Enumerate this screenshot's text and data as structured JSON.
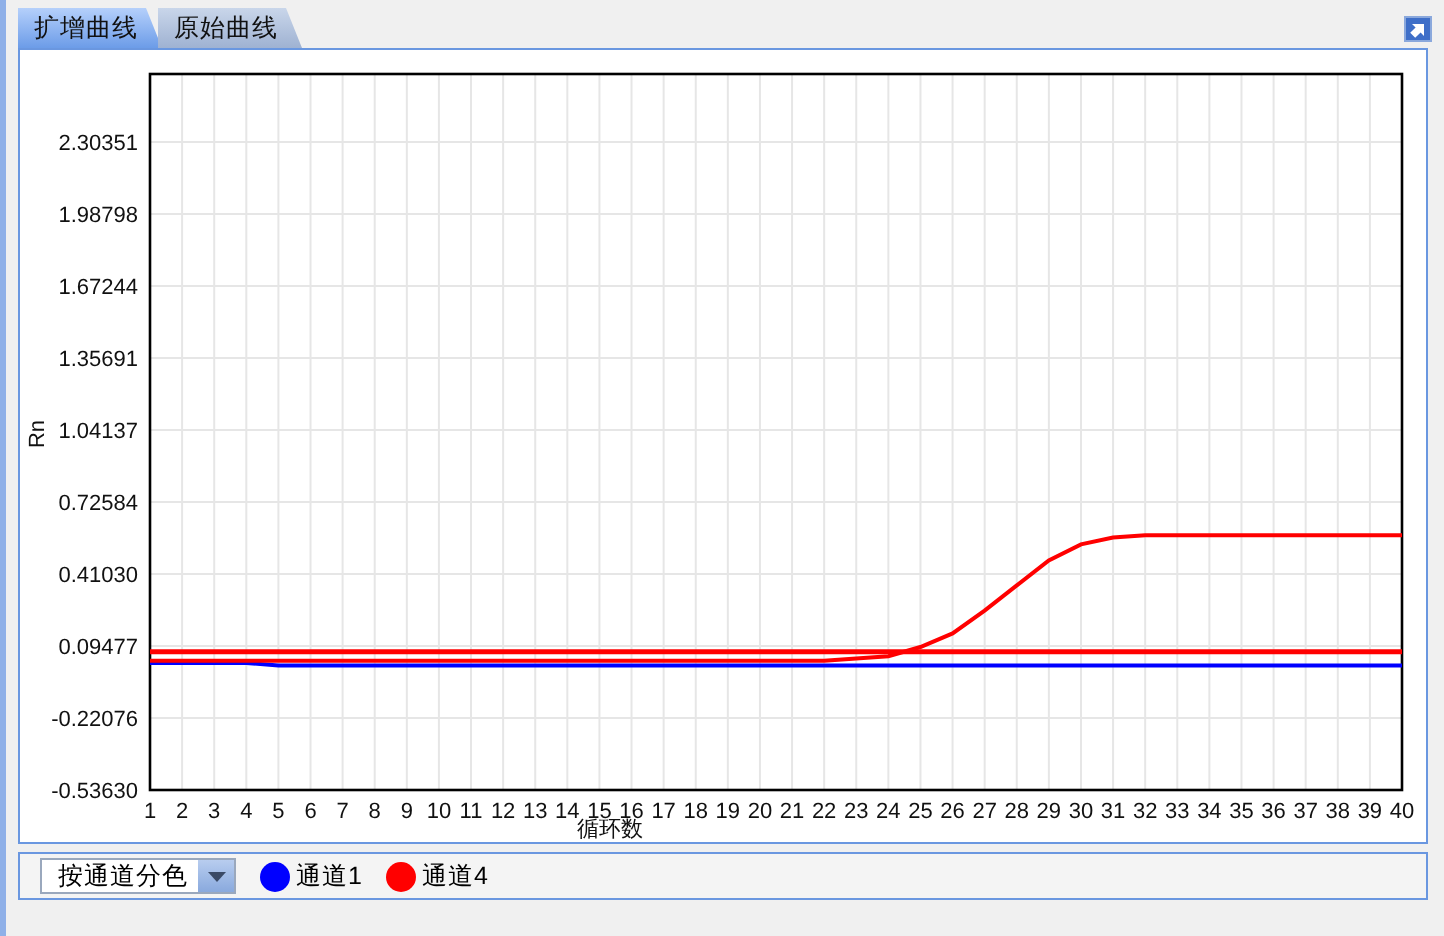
{
  "tabs": [
    {
      "label": "扩增曲线",
      "selected": true
    },
    {
      "label": "原始曲线",
      "selected": false
    }
  ],
  "chart": {
    "chart_data": {
      "type": "line",
      "xlabel": "循环数",
      "ylabel": "Rn",
      "grid": true,
      "x": [
        1,
        2,
        3,
        4,
        5,
        6,
        7,
        8,
        9,
        10,
        11,
        12,
        13,
        14,
        15,
        16,
        17,
        18,
        19,
        20,
        21,
        22,
        23,
        24,
        25,
        26,
        27,
        28,
        29,
        30,
        31,
        32,
        33,
        34,
        35,
        36,
        37,
        38,
        39,
        40
      ],
      "xlim": [
        1,
        40
      ],
      "ylim": [
        -0.5363,
        2.6015
      ],
      "xticks": [
        1,
        2,
        3,
        4,
        5,
        6,
        7,
        8,
        9,
        10,
        11,
        12,
        13,
        14,
        15,
        16,
        17,
        18,
        19,
        20,
        21,
        22,
        23,
        24,
        25,
        26,
        27,
        28,
        29,
        30,
        31,
        32,
        33,
        34,
        35,
        36,
        37,
        38,
        39,
        40
      ],
      "yticks": [
        {
          "value": -0.5363,
          "label": "-0.53630"
        },
        {
          "value": -0.22076,
          "label": "-0.22076"
        },
        {
          "value": 0.09477,
          "label": "0.09477"
        },
        {
          "value": 0.4103,
          "label": "0.41030"
        },
        {
          "value": 0.72584,
          "label": "0.72584"
        },
        {
          "value": 1.04137,
          "label": "1.04137"
        },
        {
          "value": 1.35691,
          "label": "1.35691"
        },
        {
          "value": 1.67244,
          "label": "1.67244"
        },
        {
          "value": 1.98798,
          "label": "1.98798"
        },
        {
          "value": 2.30351,
          "label": "2.30351"
        }
      ],
      "series": [
        {
          "name": "通道1",
          "color": "#0000ff",
          "values": [
            0.02,
            0.02,
            0.02,
            0.02,
            0.01,
            0.01,
            0.01,
            0.01,
            0.01,
            0.01,
            0.01,
            0.01,
            0.01,
            0.01,
            0.01,
            0.01,
            0.01,
            0.01,
            0.01,
            0.01,
            0.01,
            0.01,
            0.01,
            0.01,
            0.01,
            0.01,
            0.01,
            0.01,
            0.01,
            0.01,
            0.01,
            0.01,
            0.01,
            0.01,
            0.01,
            0.01,
            0.01,
            0.01,
            0.01,
            0.01
          ]
        },
        {
          "name": "通道4",
          "color": "#ff0000",
          "values": [
            0.03,
            0.03,
            0.03,
            0.03,
            0.03,
            0.03,
            0.03,
            0.03,
            0.03,
            0.03,
            0.03,
            0.03,
            0.03,
            0.03,
            0.03,
            0.03,
            0.03,
            0.03,
            0.03,
            0.03,
            0.03,
            0.03,
            0.04,
            0.05,
            0.09,
            0.15,
            0.25,
            0.36,
            0.47,
            0.54,
            0.57,
            0.58,
            0.58,
            0.58,
            0.58,
            0.58,
            0.58,
            0.58,
            0.58,
            0.58
          ]
        }
      ],
      "ref_lines": [
        {
          "axis": "y",
          "value": 0.07
        }
      ]
    }
  },
  "bottom_bar": {
    "color_mode": {
      "value": "按通道分色"
    }
  }
}
